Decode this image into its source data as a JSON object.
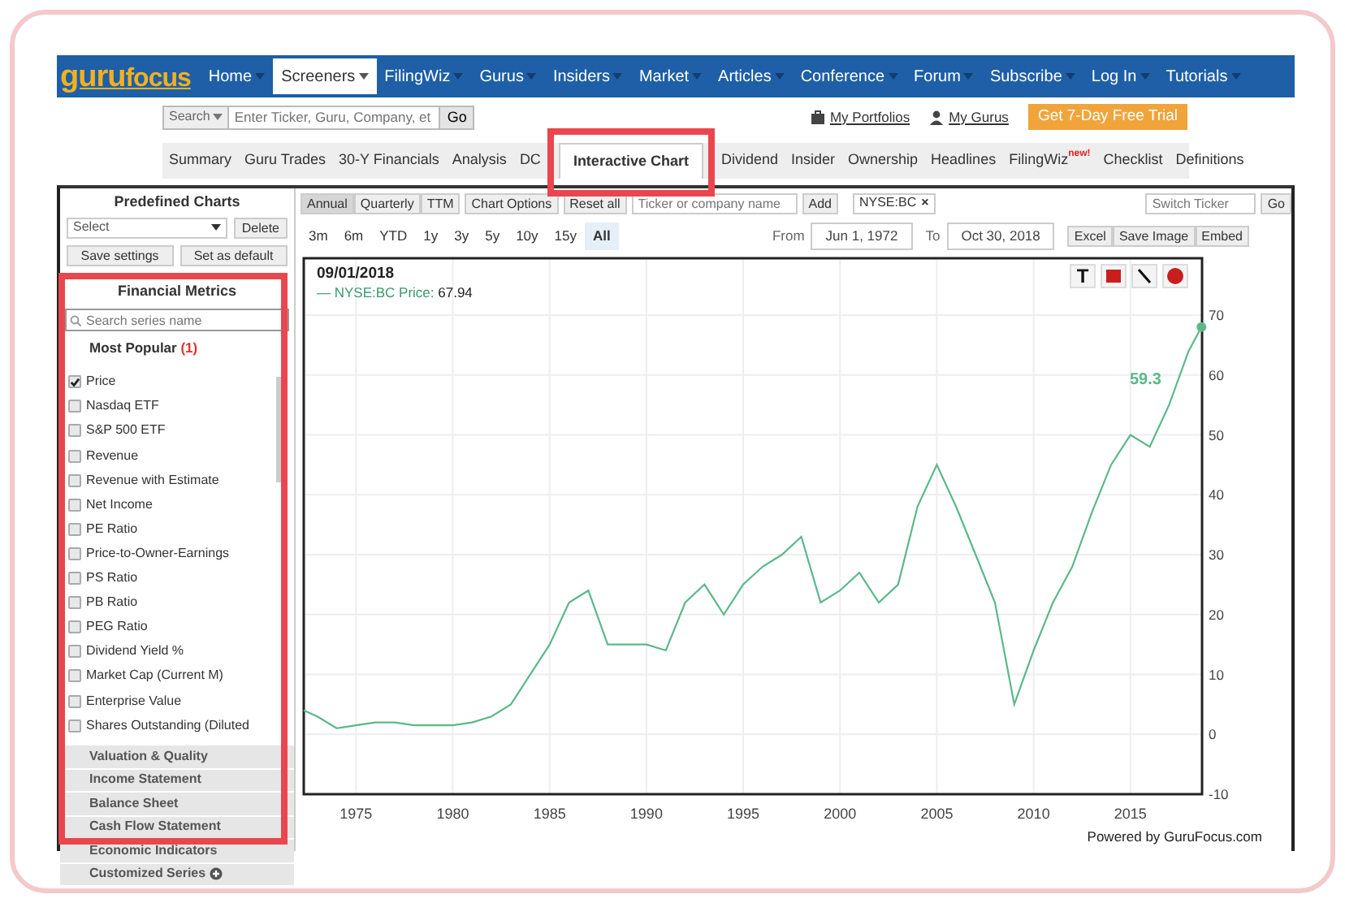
{
  "header": {
    "logo_main": "guru",
    "logo_second": "focus",
    "menu": [
      {
        "label": "Home",
        "selected": false
      },
      {
        "label": "Screeners",
        "selected": true
      },
      {
        "label": "FilingWiz",
        "selected": false
      },
      {
        "label": "Gurus",
        "selected": false
      },
      {
        "label": "Insiders",
        "selected": false
      },
      {
        "label": "Market",
        "selected": false
      },
      {
        "label": "Articles",
        "selected": false
      },
      {
        "label": "Conference",
        "selected": false
      },
      {
        "label": "Forum",
        "selected": false
      },
      {
        "label": "Subscribe",
        "selected": false
      },
      {
        "label": "Log In",
        "selected": false
      },
      {
        "label": "Tutorials",
        "selected": false
      }
    ]
  },
  "search": {
    "scope": "Search",
    "placeholder": "Enter Ticker, Guru, Company, et",
    "button": "Go"
  },
  "user_links": [
    {
      "kind": "portfolio",
      "label": "My Portfolios"
    },
    {
      "kind": "person",
      "label": "My Gurus"
    }
  ],
  "trial_button": "Get 7-Day Free Trial",
  "subnav": [
    {
      "label": "Summary",
      "selected": false,
      "highlighted": false
    },
    {
      "label": "Guru Trades",
      "selected": false,
      "highlighted": false
    },
    {
      "label": "30-Y Financials",
      "selected": false,
      "highlighted": false
    },
    {
      "label": "Analysis",
      "selected": false,
      "highlighted": false
    },
    {
      "label": "DC",
      "selected": false,
      "highlighted": false
    },
    {
      "label": "Interactive Chart",
      "selected": true,
      "highlighted": true
    },
    {
      "label": "Dividend",
      "selected": false,
      "highlighted": false
    },
    {
      "label": "Insider",
      "selected": false,
      "highlighted": false
    },
    {
      "label": "Ownership",
      "selected": false,
      "highlighted": false
    },
    {
      "label": "Headlines",
      "selected": false,
      "highlighted": false
    },
    {
      "label": "FilingWiz",
      "badge": "new!",
      "selected": false,
      "highlighted": false
    },
    {
      "label": "Checklist",
      "selected": false,
      "highlighted": false
    },
    {
      "label": "Definitions",
      "selected": false,
      "highlighted": false
    }
  ],
  "predefined": {
    "title": "Predefined Charts",
    "select": "Select",
    "delete": "Delete",
    "save": "Save settings",
    "set_default": "Set as default"
  },
  "metrics": {
    "title": "Financial Metrics",
    "highlighted": true,
    "search_placeholder": "Search series name",
    "group": "Most Popular",
    "count": "(1)",
    "items": [
      {
        "label": "Price",
        "checked": true
      },
      {
        "label": "Nasdaq ETF",
        "checked": false
      },
      {
        "label": "S&P 500 ETF",
        "checked": false
      },
      {
        "label": "Revenue",
        "checked": false
      },
      {
        "label": "Revenue with Estimate",
        "checked": false
      },
      {
        "label": "Net Income",
        "checked": false
      },
      {
        "label": "PE Ratio",
        "checked": false
      },
      {
        "label": "Price-to-Owner-Earnings",
        "checked": false
      },
      {
        "label": "PS Ratio",
        "checked": false
      },
      {
        "label": "PB Ratio",
        "checked": false
      },
      {
        "label": "PEG Ratio",
        "checked": false
      },
      {
        "label": "Dividend Yield %",
        "checked": false
      },
      {
        "label": "Market Cap (Current M)",
        "checked": false
      },
      {
        "label": "Enterprise Value",
        "checked": false
      },
      {
        "label": "Shares Outstanding (Diluted",
        "checked": false
      }
    ],
    "sections": [
      "Valuation & Quality",
      "Income Statement",
      "Balance Sheet",
      "Cash Flow Statement",
      "Economic Indicators"
    ],
    "custom": "Customized Series"
  },
  "toolbar": {
    "periods": [
      {
        "label": "Annual",
        "selected": true
      },
      {
        "label": "Quarterly",
        "selected": false
      },
      {
        "label": "TTM",
        "selected": false
      }
    ],
    "buttons": [
      "Chart Options",
      "Reset all"
    ],
    "ticker_placeholder": "Ticker or company name",
    "add": "Add",
    "tags": [
      {
        "label": "NYSE:BC",
        "close": "×"
      }
    ],
    "switch_placeholder": "Switch Ticker",
    "go": "Go"
  },
  "ranges": [
    {
      "label": "3m",
      "selected": false
    },
    {
      "label": "6m",
      "selected": false
    },
    {
      "label": "YTD",
      "selected": false
    },
    {
      "label": "1y",
      "selected": false
    },
    {
      "label": "3y",
      "selected": false
    },
    {
      "label": "5y",
      "selected": false
    },
    {
      "label": "10y",
      "selected": false
    },
    {
      "label": "15y",
      "selected": false
    },
    {
      "label": "All",
      "selected": true
    }
  ],
  "dates": {
    "from_label": "From",
    "from": "Jun 1, 1972",
    "to_label": "To",
    "to": "Oct 30, 2018"
  },
  "export_buttons": [
    "Excel",
    "Save Image",
    "Embed"
  ],
  "chart": {
    "date": "09/01/2018",
    "legend_mark": "—",
    "legend_suffix": ":",
    "legend_value": "67.94",
    "tools": [
      {
        "kind": "text",
        "label": "T"
      },
      {
        "kind": "rect"
      },
      {
        "kind": "line"
      },
      {
        "kind": "circle"
      }
    ],
    "credit": "Powered by GuruFocus.com",
    "chart_data": {
      "type": "line",
      "x": [
        1972.3,
        1973,
        1974,
        1975,
        1976,
        1977,
        1978,
        1979,
        1980,
        1981,
        1982,
        1983,
        1984,
        1985,
        1986,
        1987,
        1988,
        1989,
        1990,
        1991,
        1992,
        1993,
        1994,
        1995,
        1996,
        1997,
        1998,
        1999,
        2000,
        2001,
        2002,
        2003,
        2004,
        2005,
        2006,
        2007,
        2008,
        2009,
        2010,
        2011,
        2012,
        2013,
        2014,
        2015,
        2016,
        2017,
        2018,
        2018.67
      ],
      "series": [
        {
          "name": "NYSE:BC Price",
          "color": "#5cb88a",
          "values": [
            4,
            3,
            1,
            1.5,
            2,
            2,
            1.5,
            1.5,
            1.5,
            2,
            3,
            5,
            10,
            15,
            22,
            24,
            15,
            15,
            15,
            14,
            22,
            25,
            20,
            25,
            28,
            30,
            33,
            22,
            24,
            27,
            22,
            25,
            38,
            45,
            38,
            30,
            22,
            5,
            14,
            22,
            28,
            37,
            45,
            50,
            48,
            55,
            64,
            68
          ]
        }
      ],
      "xlim": [
        1972.3,
        2018.7
      ],
      "ylim": [
        -10,
        79.5
      ],
      "xticks": [
        1975,
        1980,
        1985,
        1990,
        1995,
        2000,
        2005,
        2010,
        2015
      ],
      "yticks": [
        -10,
        0,
        10,
        20,
        30,
        40,
        50,
        60,
        70
      ],
      "grid": true,
      "annotations": [
        "59.3"
      ]
    }
  }
}
